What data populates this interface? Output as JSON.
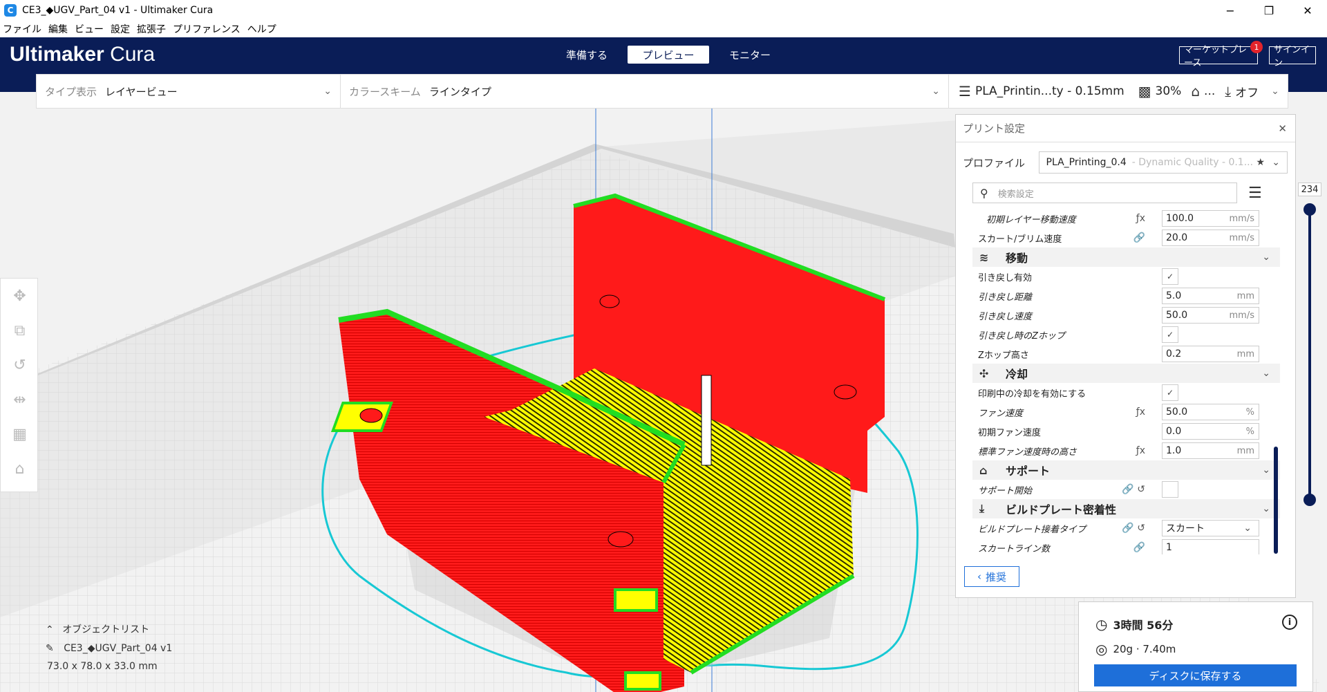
{
  "window": {
    "title": "CE3_◆UGV_Part_04 v1 - Ultimaker Cura",
    "controls": [
      "−",
      "❐",
      "✕"
    ]
  },
  "menu": [
    "ファイル",
    "編集",
    "ビュー",
    "設定",
    "拡張子",
    "プリファレンス",
    "ヘルプ"
  ],
  "header": {
    "logo_bold": "Ultimaker",
    "logo_light": "Cura",
    "tabs": [
      {
        "label": "準備する",
        "active": false
      },
      {
        "label": "プレビュー",
        "active": true
      },
      {
        "label": "モニター",
        "active": false
      }
    ],
    "marketplace_label": "マーケットプレース",
    "marketplace_badge": "1",
    "signin_label": "サインイン",
    "bg_color": "#0a1d57"
  },
  "view_toolbar": {
    "type_label": "タイプ表示",
    "type_value": "レイヤービュー",
    "color_label": "カラースキーム",
    "color_value": "ラインタイプ",
    "profile_summary": "PLA_Printin...ty - 0.15mm",
    "infill": "30%",
    "support_summary": "...",
    "adhesion": "オフ"
  },
  "print_settings": {
    "title": "プリント設定",
    "profile_label": "プロファイル",
    "profile_name": "PLA_Printing_0.4",
    "profile_dim": "- Dynamic Quality - 0.1...",
    "search_placeholder": "検索設定",
    "rows": [
      {
        "kind": "setting",
        "label": "初期レイヤー移動速度",
        "italic": true,
        "indent": true,
        "icons": "ƒx",
        "value": "100.0",
        "unit": "mm/s"
      },
      {
        "kind": "setting",
        "label": "スカート/ブリム速度",
        "icons": "🔗",
        "value": "20.0",
        "unit": "mm/s"
      },
      {
        "kind": "category",
        "label": "移動",
        "icon": "≋"
      },
      {
        "kind": "check",
        "label": "引き戻し有効",
        "checked": "✓"
      },
      {
        "kind": "setting",
        "label": "引き戻し距離",
        "italic": true,
        "value": "5.0",
        "unit": "mm"
      },
      {
        "kind": "setting",
        "label": "引き戻し速度",
        "italic": true,
        "value": "50.0",
        "unit": "mm/s"
      },
      {
        "kind": "check",
        "label": "引き戻し時のZホップ",
        "italic": true,
        "checked": "✓"
      },
      {
        "kind": "setting",
        "label": "Zホップ高さ",
        "value": "0.2",
        "unit": "mm"
      },
      {
        "kind": "category",
        "label": "冷却",
        "icon": "✣"
      },
      {
        "kind": "check",
        "label": "印刷中の冷却を有効にする",
        "checked": "✓"
      },
      {
        "kind": "setting",
        "label": "ファン速度",
        "italic": true,
        "icons": "ƒx",
        "value": "50.0",
        "unit": "%"
      },
      {
        "kind": "setting",
        "label": "初期ファン速度",
        "value": "0.0",
        "unit": "%"
      },
      {
        "kind": "setting",
        "label": "標準ファン速度時の高さ",
        "italic": true,
        "icons": "ƒx",
        "value": "1.0",
        "unit": "mm"
      },
      {
        "kind": "category",
        "label": "サポート",
        "icon": "⌂"
      },
      {
        "kind": "check",
        "label": "サポート開始",
        "italic": true,
        "icons": "🔗 ↺",
        "checked": ""
      },
      {
        "kind": "category",
        "label": "ビルドプレート密着性",
        "icon": "⤓"
      },
      {
        "kind": "select",
        "label": "ビルドプレート接着タイプ",
        "italic": true,
        "icons": "🔗 ↺",
        "value": "スカート"
      },
      {
        "kind": "setting",
        "label": "スカートライン数",
        "italic": true,
        "icons": "🔗",
        "value": "1",
        "unit": ""
      }
    ],
    "recommended_label": "推奨"
  },
  "layer_slider": {
    "max_layer": "234"
  },
  "object_list": {
    "toggle_label": "オブジェクトリスト",
    "object_name": "CE3_◆UGV_Part_04 v1",
    "dimensions": "73.0 x 78.0 x 33.0 mm"
  },
  "job": {
    "time": "3時間 56分",
    "material": "20g · 7.40m",
    "save_label": "ディスクに保存する"
  },
  "tools": [
    "move-icon",
    "scale-icon",
    "rotate-icon",
    "mirror-icon",
    "per-model-settings-icon",
    "support-blocker-icon"
  ]
}
